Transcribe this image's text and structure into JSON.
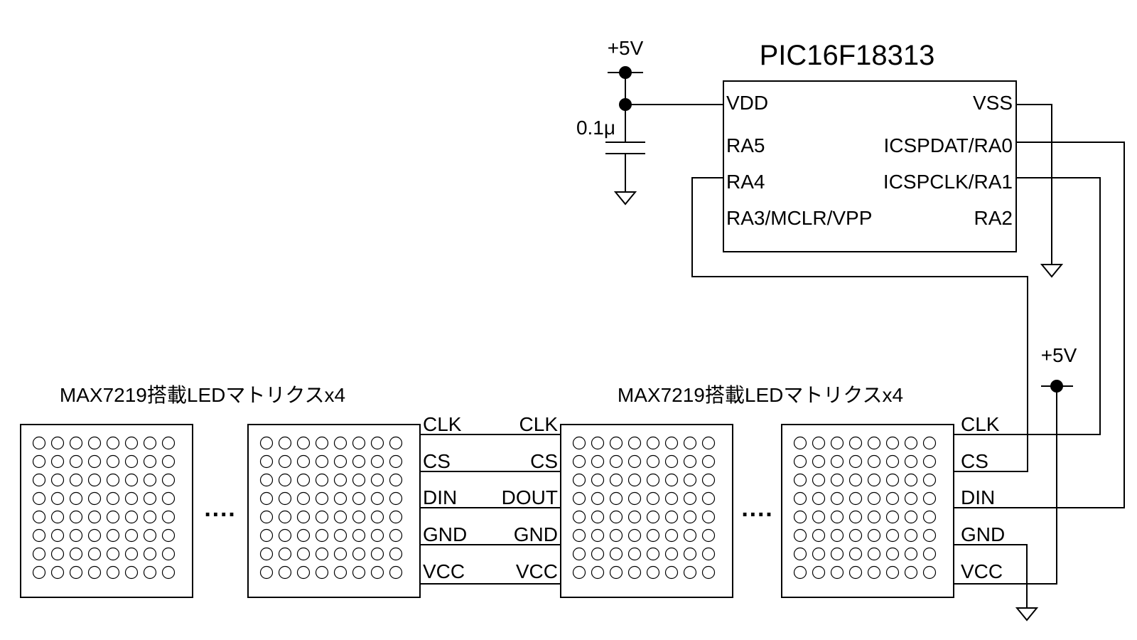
{
  "mcu": {
    "title": "PIC16F18313",
    "left_pins": [
      "VDD",
      "RA5",
      "RA4",
      "RA3/MCLR/VPP"
    ],
    "right_pins": [
      "VSS",
      "ICSPDAT/RA0",
      "ICSPCLK/RA1",
      "RA2"
    ]
  },
  "power": {
    "vcc_top": "+5V",
    "vcc_right": "+5V",
    "cap_value": "0.1μ"
  },
  "modules": {
    "group_left_title": "MAX7219搭載LEDマトリクスx4",
    "group_right_title": "MAX7219搭載LEDマトリクスx4",
    "input_pins": [
      "CLK",
      "CS",
      "DIN",
      "GND",
      "VCC"
    ],
    "output_pins": [
      "CLK",
      "CS",
      "DOUT",
      "GND",
      "VCC"
    ],
    "ellipsis": "····"
  },
  "matrix": {
    "rows": 8,
    "cols": 8
  }
}
